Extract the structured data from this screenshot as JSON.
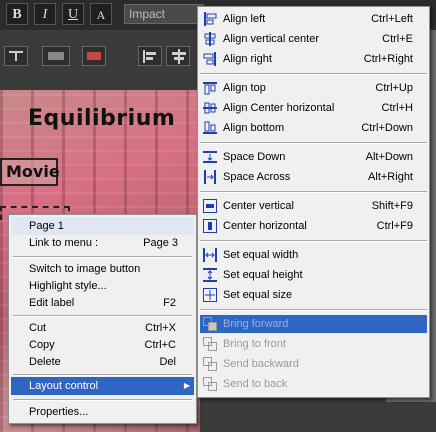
{
  "toolbar": {
    "bold_label": "B",
    "italic_label": "I",
    "underline_label": "U",
    "text_color_label": "A",
    "font_name": "Impact"
  },
  "canvas": {
    "title": "Equilibrium",
    "button_text": "Movie"
  },
  "context_menu": {
    "items": [
      {
        "label": "Page 1",
        "shortcut": ""
      },
      {
        "label": "Link to menu :",
        "shortcut": "Page 3"
      },
      {
        "label": "Switch to image button",
        "shortcut": ""
      },
      {
        "label": "Highlight style...",
        "shortcut": ""
      },
      {
        "label": "Edit label",
        "shortcut": "F2"
      },
      {
        "label": "Cut",
        "shortcut": "Ctrl+X"
      },
      {
        "label": "Copy",
        "shortcut": "Ctrl+C"
      },
      {
        "label": "Delete",
        "shortcut": "Del"
      },
      {
        "label": "Layout control",
        "shortcut": ""
      },
      {
        "label": "Properties...",
        "shortcut": ""
      }
    ]
  },
  "layout_submenu": {
    "items": [
      {
        "label": "Align left",
        "shortcut": "Ctrl+Left",
        "icon": "align-left-icon"
      },
      {
        "label": "Align vertical center",
        "shortcut": "Ctrl+E",
        "icon": "align-vcenter-icon"
      },
      {
        "label": "Align right",
        "shortcut": "Ctrl+Right",
        "icon": "align-right-icon"
      },
      {
        "label": "Align top",
        "shortcut": "Ctrl+Up",
        "icon": "align-top-icon"
      },
      {
        "label": "Align Center horizontal",
        "shortcut": "Ctrl+H",
        "icon": "align-hcenter-icon"
      },
      {
        "label": "Align bottom",
        "shortcut": "Ctrl+Down",
        "icon": "align-bottom-icon"
      },
      {
        "label": "Space Down",
        "shortcut": "Alt+Down",
        "icon": "space-down-icon"
      },
      {
        "label": "Space Across",
        "shortcut": "Alt+Right",
        "icon": "space-across-icon"
      },
      {
        "label": "Center vertical",
        "shortcut": "Shift+F9",
        "icon": "center-vertical-icon"
      },
      {
        "label": "Center horizontal",
        "shortcut": "Ctrl+F9",
        "icon": "center-horizontal-icon"
      },
      {
        "label": "Set equal width",
        "shortcut": "",
        "icon": "equal-width-icon"
      },
      {
        "label": "Set equal height",
        "shortcut": "",
        "icon": "equal-height-icon"
      },
      {
        "label": "Set equal size",
        "shortcut": "",
        "icon": "equal-size-icon"
      },
      {
        "label": "Bring forward",
        "shortcut": "",
        "icon": "bring-forward-icon"
      },
      {
        "label": "Bring to front",
        "shortcut": "",
        "icon": "bring-to-front-icon"
      },
      {
        "label": "Send backward",
        "shortcut": "",
        "icon": "send-backward-icon"
      },
      {
        "label": "Send to back",
        "shortcut": "",
        "icon": "send-to-back-icon"
      }
    ]
  },
  "colors": {
    "highlight": "#2f66c4",
    "menu_bg": "#f0f0f0",
    "icon_blue": "#1f3fb0",
    "disabled_text": "#9a9a9a"
  }
}
